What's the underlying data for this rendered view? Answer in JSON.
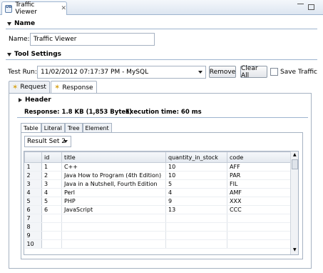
{
  "window": {
    "tab_title": "Traffic Viewer",
    "icon": "database-icon"
  },
  "name_section": {
    "title": "Name",
    "label": "Name:",
    "value": "Traffic Viewer"
  },
  "tool_settings": {
    "title": "Tool Settings",
    "test_run_label": "Test Run:",
    "test_run_value": "11/02/2012 07:17:37 PM - MySQL",
    "remove_label": "Remove",
    "clear_all_label": "Clear All",
    "save_traffic_label": "Save Traffic"
  },
  "tabs": [
    {
      "label": "Request",
      "icon": "request-icon"
    },
    {
      "label": "Response",
      "icon": "response-icon"
    }
  ],
  "response": {
    "header_title": "Header",
    "summary": "Response: 1.8 KB (1,853 Bytes)",
    "execution": "Execution time: 60 ms",
    "view_tabs": [
      "Table",
      "Literal",
      "Tree",
      "Element"
    ],
    "result_set": "Result Set 2",
    "columns": [
      "id",
      "title",
      "quantity_in_stock",
      "code"
    ],
    "rows": [
      {
        "n": "1",
        "id": "1",
        "title": "C++",
        "qty": "10",
        "code": "AFF"
      },
      {
        "n": "2",
        "id": "2",
        "title": "Java How to Program (4th Edition)",
        "qty": "10",
        "code": "PAR"
      },
      {
        "n": "3",
        "id": "3",
        "title": "Java in a Nutshell, Fourth Edition",
        "qty": "5",
        "code": "FIL"
      },
      {
        "n": "4",
        "id": "4",
        "title": "Perl",
        "qty": "4",
        "code": "AMF"
      },
      {
        "n": "5",
        "id": "5",
        "title": "PHP",
        "qty": "9",
        "code": "XXX"
      },
      {
        "n": "6",
        "id": "6",
        "title": "JavaScript",
        "qty": "13",
        "code": "CCC"
      },
      {
        "n": "7",
        "id": "",
        "title": "",
        "qty": "",
        "code": ""
      },
      {
        "n": "8",
        "id": "",
        "title": "",
        "qty": "",
        "code": ""
      },
      {
        "n": "9",
        "id": "",
        "title": "",
        "qty": "",
        "code": ""
      },
      {
        "n": "10",
        "id": "",
        "title": "",
        "qty": "",
        "code": ""
      }
    ]
  }
}
